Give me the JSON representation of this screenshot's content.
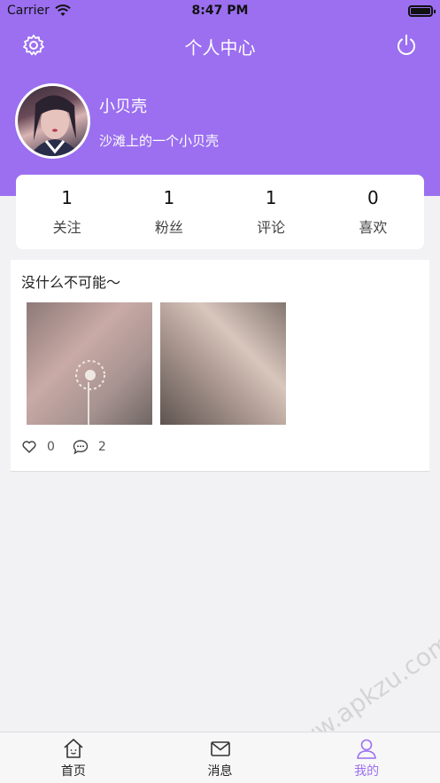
{
  "status_bar": {
    "carrier": "Carrier",
    "time": "8:47 PM"
  },
  "header": {
    "title": "个人中心"
  },
  "profile": {
    "username": "小贝壳",
    "bio": "沙滩上的一个小贝壳"
  },
  "stats": [
    {
      "value": "1",
      "label": "关注"
    },
    {
      "value": "1",
      "label": "粉丝"
    },
    {
      "value": "1",
      "label": "评论"
    },
    {
      "value": "0",
      "label": "喜欢"
    }
  ],
  "post": {
    "text": "没什么不可能～",
    "likes": "0",
    "comments": "2"
  },
  "watermark": "www.apkzu.com",
  "tabbar": [
    {
      "label": "首页",
      "icon": "home-icon"
    },
    {
      "label": "消息",
      "icon": "mail-icon"
    },
    {
      "label": "我的",
      "icon": "user-icon"
    }
  ],
  "colors": {
    "accent": "#9b6ff0",
    "background": "#f2f2f4"
  }
}
